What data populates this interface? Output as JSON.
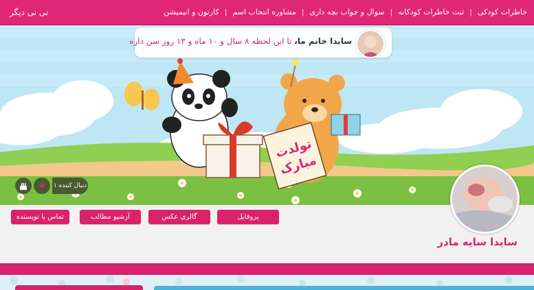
{
  "header": {
    "logo_link": "نی نی دیگر",
    "nav": [
      {
        "label": "خاطرات کودکی"
      },
      {
        "label": "ثبت خاطرات کودکانه"
      },
      {
        "label": "سوال و جواب بچه داری"
      },
      {
        "label": "مشاوره انتخاب اسم"
      },
      {
        "label": "کارتون و انیمیشن"
      }
    ]
  },
  "banner": {
    "bubble_name": "سایدا خانم ما،",
    "bubble_text": " تا این لحظه ۸ سال و ۱۰ ماه و ۱۳ روز سن داره",
    "card_line1": "تولدت",
    "card_line2": "مبارک"
  },
  "follow": {
    "count_label": "۱ دنبال کننده"
  },
  "tabs": {
    "profile": "پروفایل",
    "gallery": "گالری عکس",
    "archive": "آرشیو مطالب",
    "contact": "تماس با نویسنده"
  },
  "profile": {
    "name": "سایدا سایه مادر"
  },
  "colors": {
    "brand_pink": "#e02775",
    "accent_pink": "#d8236b",
    "sky": "#bfe6f5",
    "grass": "#7bc043"
  }
}
